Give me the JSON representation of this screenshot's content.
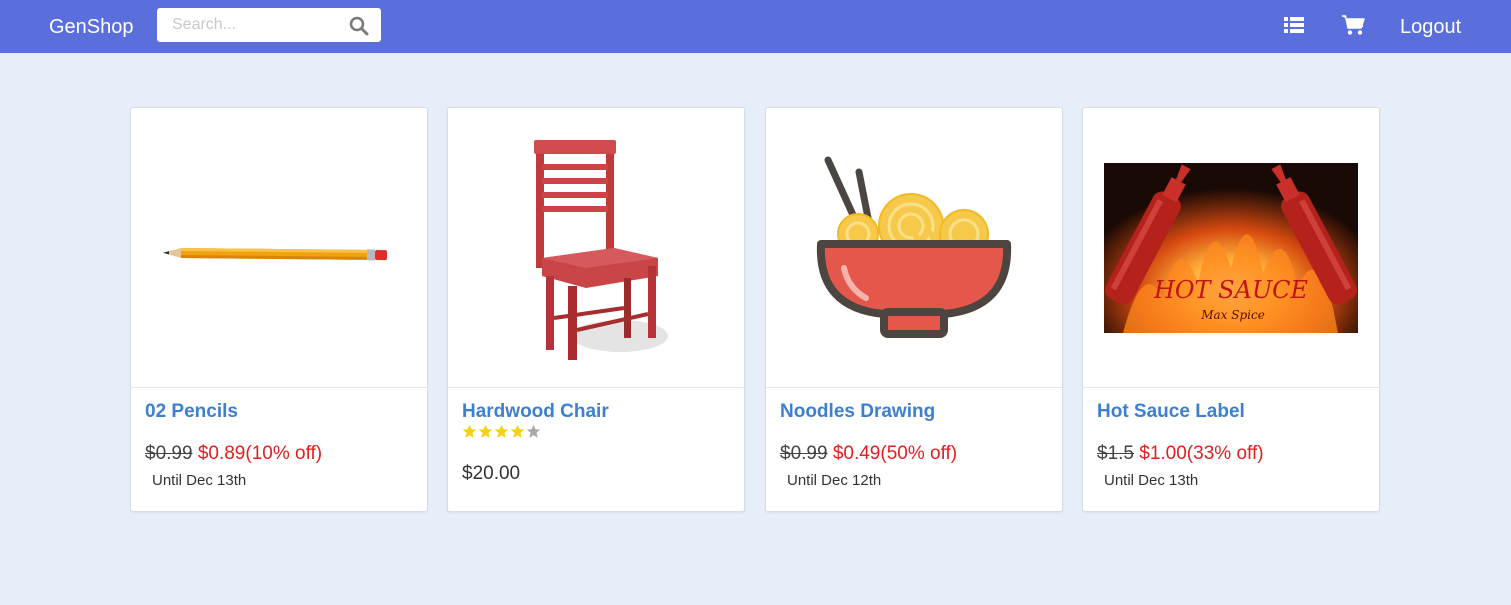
{
  "app": {
    "brand": "GenShop"
  },
  "header": {
    "search_placeholder": "Search...",
    "logout_label": "Logout",
    "icons": [
      "search-icon",
      "list-icon",
      "cart-icon"
    ]
  },
  "colors": {
    "navbar": "#5a6fdc",
    "background": "#e6eef9",
    "title_link": "#3d7fd0",
    "sale_price": "#e21f1f",
    "star": "#f5d018"
  },
  "products": [
    {
      "title": "02 Pencils",
      "image": "pencil",
      "old_price": "$0.99",
      "new_price": "$0.89(10% off)",
      "until": "Until Dec 13th"
    },
    {
      "title": "Hardwood Chair",
      "image": "chair",
      "rating": 4,
      "rating_max": 5,
      "price": "$20.00"
    },
    {
      "title": "Noodles Drawing",
      "image": "noodle-bowl",
      "old_price": "$0.99",
      "new_price": "$0.49(50% off)",
      "until": "Until Dec 12th"
    },
    {
      "title": "Hot Sauce Label",
      "image": "hot-sauce-label",
      "image_text": "HOT SAUCE",
      "image_subtext": "Max Spice",
      "old_price": "$1.5",
      "new_price": "$1.00(33% off)",
      "until": "Until Dec 13th"
    }
  ]
}
